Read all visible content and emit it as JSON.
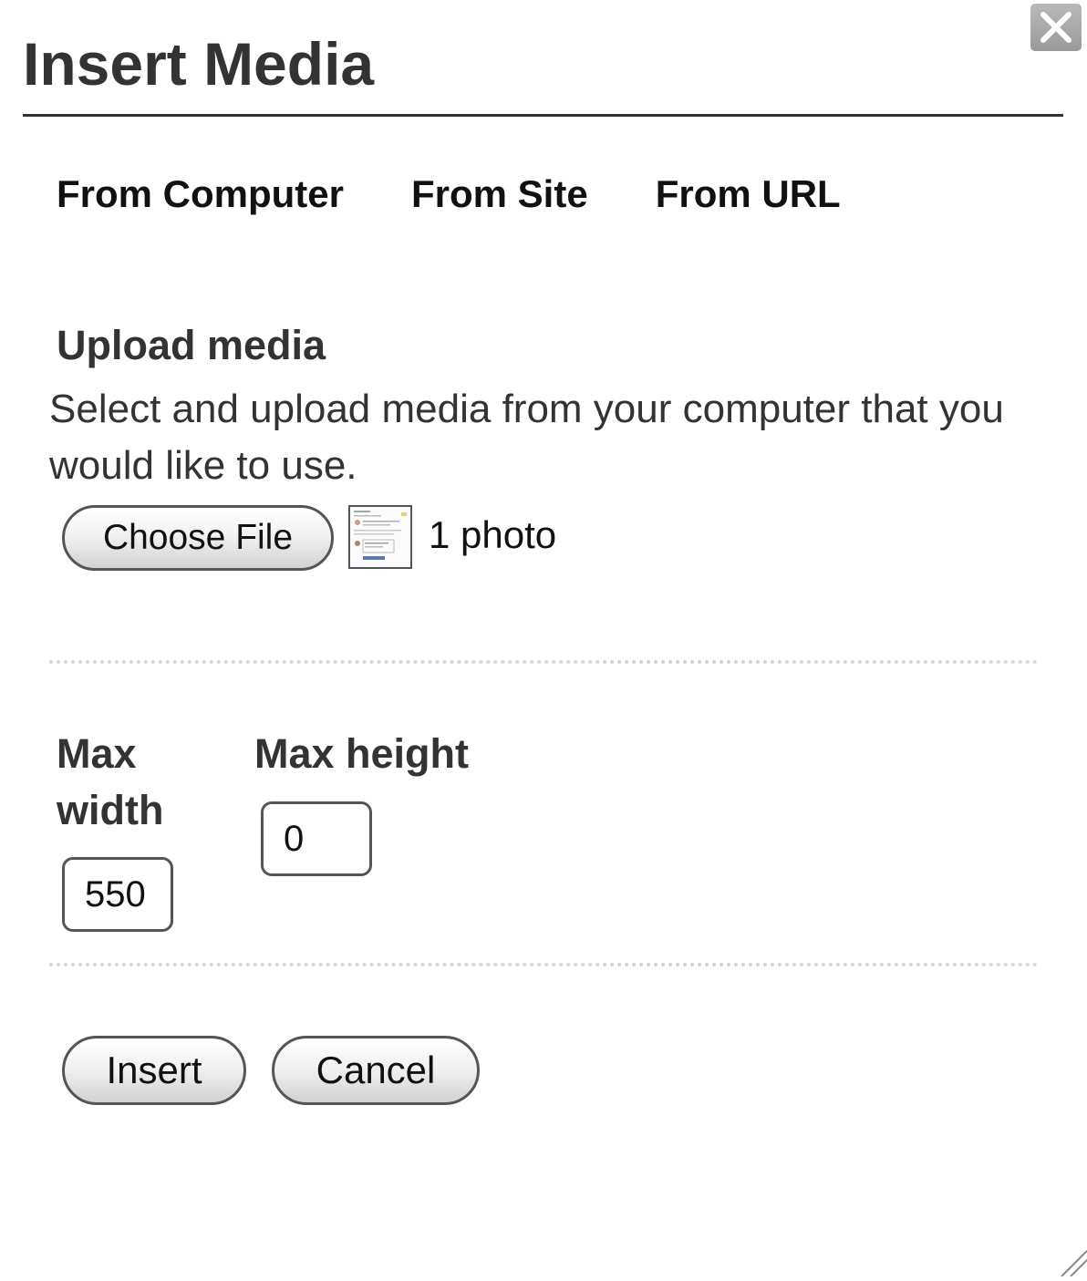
{
  "dialog": {
    "title": "Insert Media",
    "close_icon": "close-x-icon"
  },
  "tabs": [
    {
      "label": "From Computer"
    },
    {
      "label": "From Site"
    },
    {
      "label": "From URL"
    }
  ],
  "upload": {
    "heading": "Upload media",
    "description": "Select and upload media from your computer that you would like to use.",
    "choose_file_label": "Choose File",
    "file_status": "1 photo"
  },
  "dimensions": {
    "max_width_label": "Max width",
    "max_width_value": "550",
    "max_height_label": "Max height",
    "max_height_value": "0"
  },
  "actions": {
    "insert_label": "Insert",
    "cancel_label": "Cancel"
  }
}
